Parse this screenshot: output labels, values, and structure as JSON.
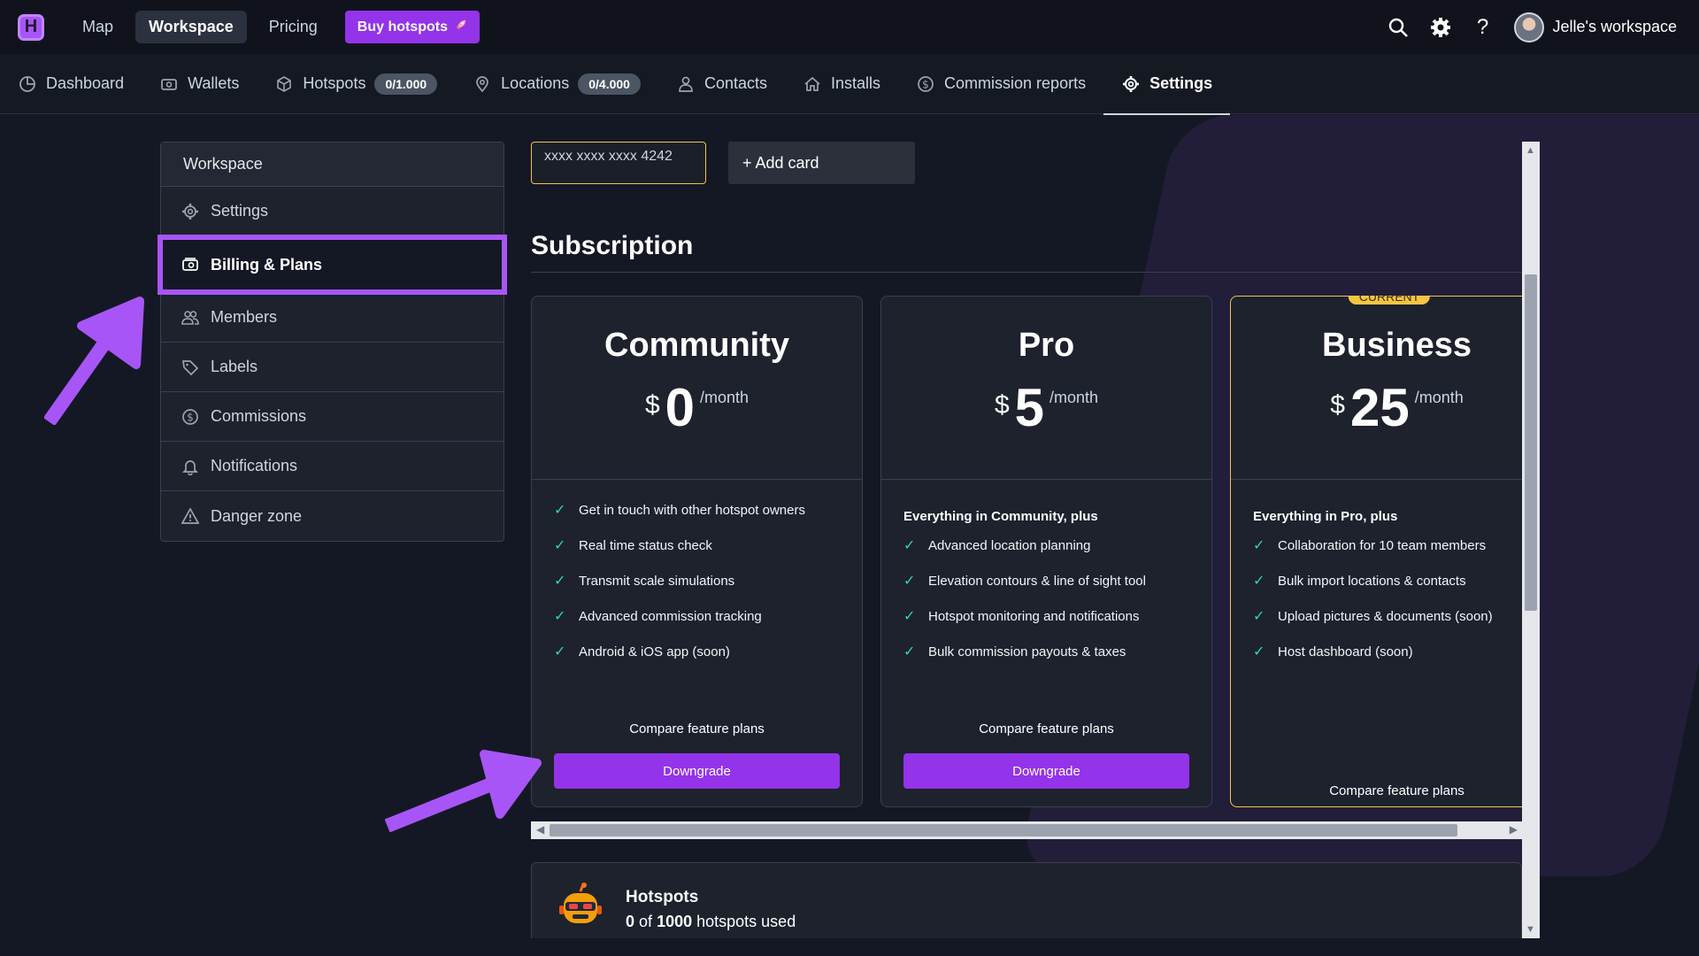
{
  "colors": {
    "accent": "#a855f7",
    "button": "#9333ea",
    "current": "#f5c542",
    "check": "#2dd4bf",
    "background": "#141824"
  },
  "topbar": {
    "logo_letter": "H",
    "nav": [
      {
        "label": "Map",
        "active": false
      },
      {
        "label": "Workspace",
        "active": true
      },
      {
        "label": "Pricing",
        "active": false
      }
    ],
    "buy_label": "Buy hotspots",
    "buy_icon": "rocket-icon",
    "workspace_name": "Jelle's workspace",
    "help_label": "?"
  },
  "tabs": [
    {
      "label": "Dashboard",
      "icon": "dashboard-icon"
    },
    {
      "label": "Wallets",
      "icon": "wallet-icon"
    },
    {
      "label": "Hotspots",
      "icon": "cube-icon",
      "badge": "0/1.000"
    },
    {
      "label": "Locations",
      "icon": "pin-icon",
      "badge": "0/4.000"
    },
    {
      "label": "Contacts",
      "icon": "user-icon"
    },
    {
      "label": "Installs",
      "icon": "home-icon"
    },
    {
      "label": "Commission reports",
      "icon": "dollar-icon"
    },
    {
      "label": "Settings",
      "icon": "gear-icon",
      "active": true
    }
  ],
  "sidebar": {
    "header": "Workspace",
    "items": [
      {
        "label": "Settings",
        "icon": "gear-icon"
      },
      {
        "label": "Billing & Plans",
        "icon": "billing-icon",
        "active": true
      },
      {
        "label": "Members",
        "icon": "members-icon"
      },
      {
        "label": "Labels",
        "icon": "tag-icon"
      },
      {
        "label": "Commissions",
        "icon": "dollar-icon"
      },
      {
        "label": "Notifications",
        "icon": "bell-icon"
      },
      {
        "label": "Danger zone",
        "icon": "warning-icon"
      }
    ]
  },
  "billing": {
    "card_number": "xxxx xxxx xxxx 4242",
    "add_card_label": "+ Add card"
  },
  "subscription": {
    "title": "Subscription",
    "plans": [
      {
        "name": "Community",
        "currency": "$",
        "amount": "0",
        "period": "/month",
        "intro": "",
        "features": [
          "Get in touch with other hotspot owners",
          "Real time status check",
          "Transmit scale simulations",
          "Advanced commission tracking",
          "Android & iOS app (soon)"
        ],
        "compare_label": "Compare feature plans",
        "button_label": "Downgrade"
      },
      {
        "name": "Pro",
        "currency": "$",
        "amount": "5",
        "period": "/month",
        "intro": "Everything in Community, plus",
        "features": [
          "Advanced location planning",
          "Elevation contours & line of sight tool",
          "Hotspot monitoring and notifications",
          "Bulk commission payouts & taxes"
        ],
        "compare_label": "Compare feature plans",
        "button_label": "Downgrade"
      },
      {
        "name": "Business",
        "currency": "$",
        "amount": "25",
        "period": "/month",
        "badge": "CURRENT",
        "intro": "Everything in Pro, plus",
        "features": [
          "Collaboration for 10 team members",
          "Bulk import locations & contacts",
          "Upload pictures & documents (soon)",
          "Host dashboard (soon)"
        ],
        "compare_label": "Compare feature plans"
      }
    ]
  },
  "hotspots_usage": {
    "title": "Hotspots",
    "used": "0",
    "of_word": "of",
    "total": "1000",
    "suffix": "hotspots used"
  }
}
